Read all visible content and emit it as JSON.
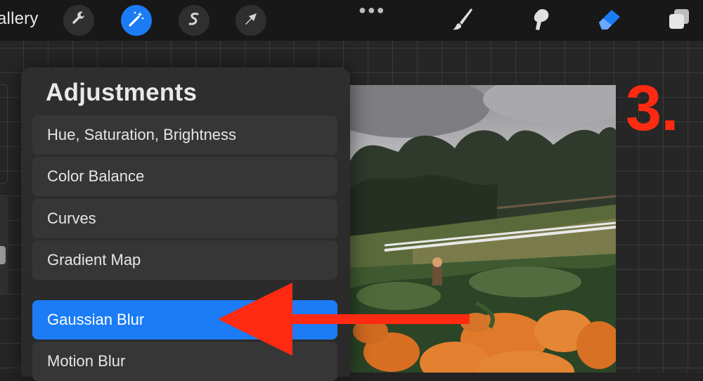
{
  "toolbar": {
    "gallery_label": "allery",
    "tools": [
      {
        "icon": "wrench-icon",
        "active": false
      },
      {
        "icon": "magic-wand-icon",
        "active": true
      },
      {
        "icon": "selection-s-icon",
        "active": false
      },
      {
        "icon": "arrow-cursor-icon",
        "active": false
      }
    ],
    "more_icon": "dots-icon",
    "right_tools": [
      "brush-icon",
      "smudge-icon",
      "eraser-icon",
      "layers-icon"
    ]
  },
  "panel": {
    "title": "Adjustments",
    "items": [
      {
        "label": "Hue, Saturation, Brightness",
        "selected": false
      },
      {
        "label": "Color Balance",
        "selected": false
      },
      {
        "label": "Curves",
        "selected": false
      },
      {
        "label": "Gradient Map",
        "selected": false
      },
      {
        "label": "Gaussian Blur",
        "selected": true
      },
      {
        "label": "Motion Blur",
        "selected": false
      }
    ]
  },
  "annotation": {
    "step_label": "3.",
    "arrow_color": "#ff2a12"
  },
  "colors": {
    "accent": "#1b7cf5",
    "annotation": "#ff2a12"
  }
}
